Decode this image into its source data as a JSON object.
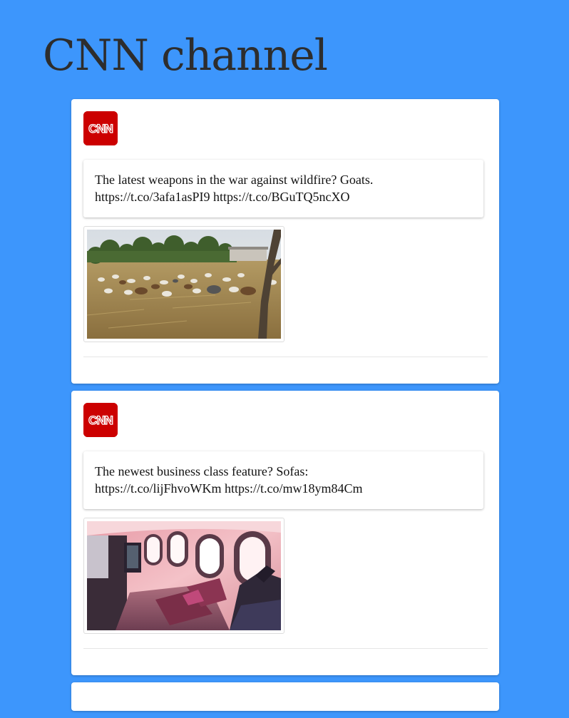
{
  "page": {
    "title": "CNN channel"
  },
  "brand": {
    "logo_text": "CNN",
    "logo_color": "#cc0000",
    "background_color": "#3d96fc"
  },
  "posts": [
    {
      "text_line1": "The latest weapons in the war against wildfire? Goats.",
      "text_line2": "https://t.co/3afa1asPI9 https://t.co/BGuTQ5ncXO",
      "image_icon": "goats-grazing-photo"
    },
    {
      "text_line1": "The newest business class feature? Sofas:",
      "text_line2": "https://t.co/lijFhvoWKm https://t.co/mw18ym84Cm",
      "image_icon": "airplane-cabin-photo"
    }
  ]
}
